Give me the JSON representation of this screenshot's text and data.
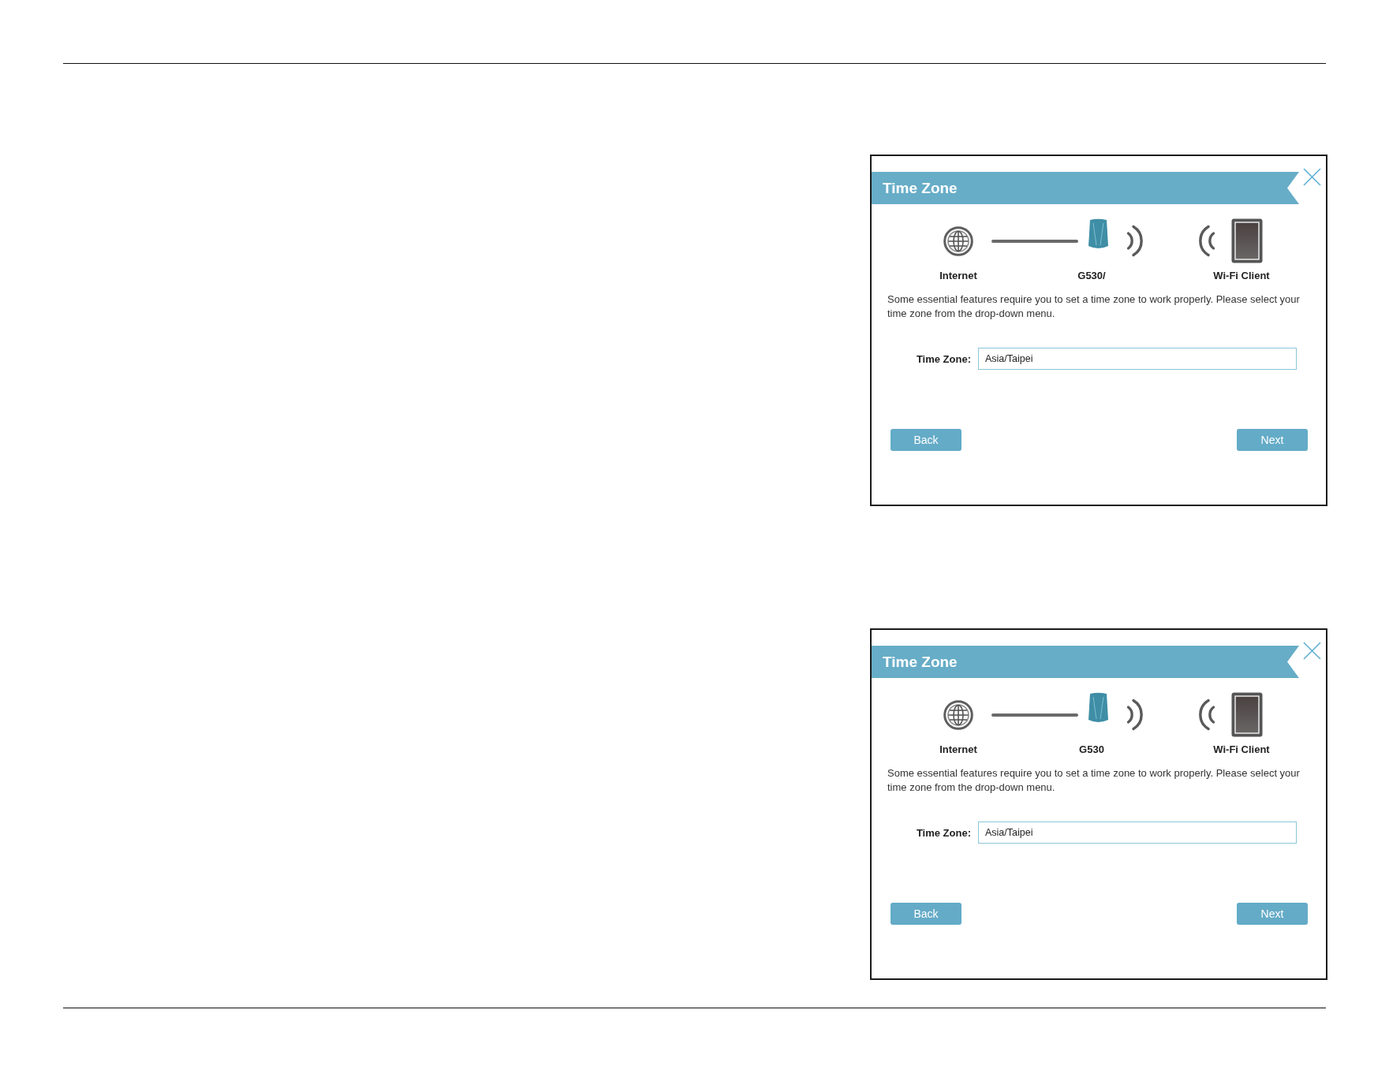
{
  "panels": [
    {
      "title": "Time Zone",
      "nodes": [
        {
          "kind": "internet",
          "label": "Internet"
        },
        {
          "kind": "router",
          "label": "G530/"
        },
        {
          "kind": "client",
          "label": "Wi-Fi Client"
        }
      ],
      "description": "Some essential features require you to set a time zone to work properly. Please select your time zone from the drop-down menu.",
      "time_zone": {
        "label": "Time Zone:",
        "value": "Asia/Taipei"
      },
      "buttons": [
        "Back",
        "Next"
      ]
    },
    {
      "title": "Time Zone",
      "nodes": [
        {
          "kind": "internet",
          "label": "Internet"
        },
        {
          "kind": "router",
          "label": "G530"
        },
        {
          "kind": "client",
          "label": "Wi-Fi Client"
        }
      ],
      "description": "Some essential features require you to set a time zone to work properly. Please select your time zone from the drop-down menu.",
      "time_zone": {
        "label": "Time Zone:",
        "value": "Asia/Taipei"
      },
      "buttons": [
        "Back",
        "Next"
      ]
    }
  ]
}
